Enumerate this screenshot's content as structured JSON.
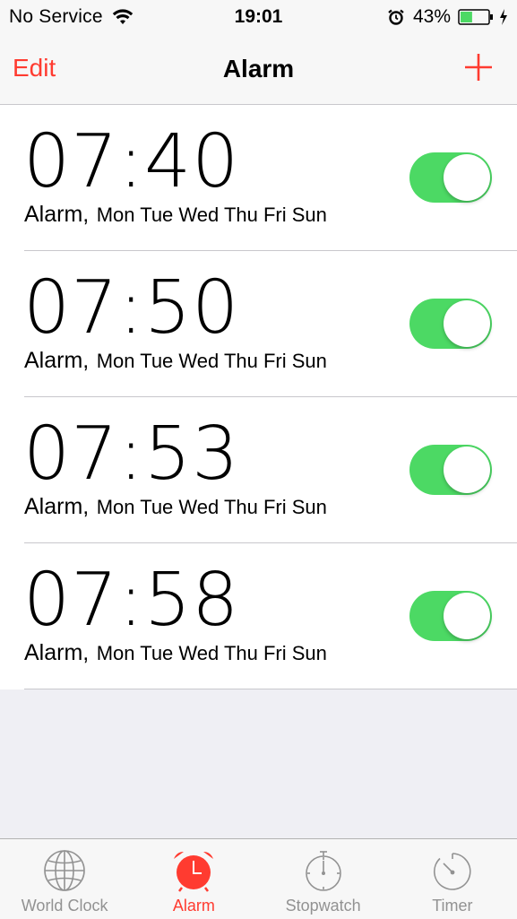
{
  "status_bar": {
    "carrier": "No Service",
    "time": "19:01",
    "battery_percent": "43%",
    "battery_level": 0.43,
    "icons": [
      "wifi-icon",
      "alarm-clock-icon",
      "battery-icon",
      "charging-icon"
    ]
  },
  "nav": {
    "edit_label": "Edit",
    "title": "Alarm",
    "add_icon": "plus-icon",
    "accent_color": "#ff3b30"
  },
  "alarms": [
    {
      "time": "07:40",
      "label": "Alarm,",
      "days": "Mon Tue Wed Thu Fri Sun",
      "enabled": true
    },
    {
      "time": "07:50",
      "label": "Alarm,",
      "days": "Mon Tue Wed Thu Fri Sun",
      "enabled": true
    },
    {
      "time": "07:53",
      "label": "Alarm,",
      "days": "Mon Tue Wed Thu Fri Sun",
      "enabled": true
    },
    {
      "time": "07:58",
      "label": "Alarm,",
      "days": "Mon Tue Wed Thu Fri Sun",
      "enabled": true
    }
  ],
  "toggle_on_color": "#4cd964",
  "tabs": [
    {
      "label": "World Clock",
      "icon": "globe-icon",
      "active": false
    },
    {
      "label": "Alarm",
      "icon": "alarm-clock-icon",
      "active": true
    },
    {
      "label": "Stopwatch",
      "icon": "stopwatch-icon",
      "active": false
    },
    {
      "label": "Timer",
      "icon": "timer-icon",
      "active": false
    }
  ]
}
